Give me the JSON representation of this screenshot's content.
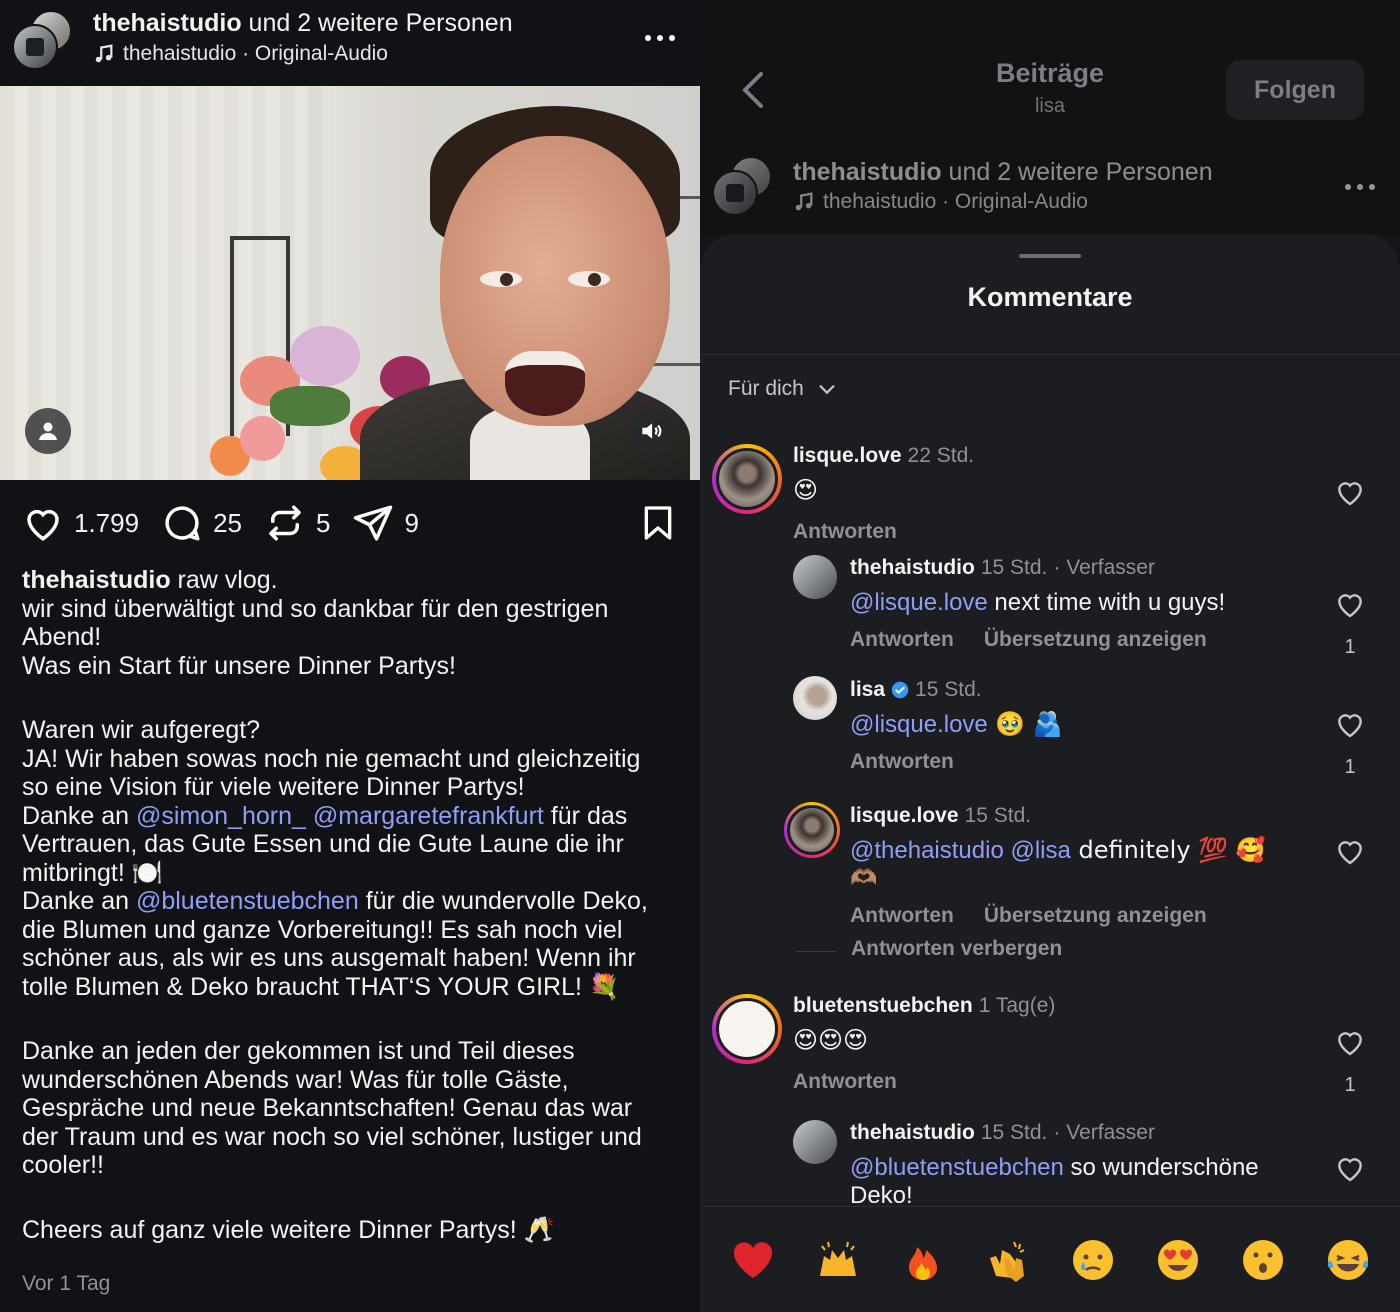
{
  "post": {
    "header": {
      "author": "thehaistudio",
      "coauthors_text": " und 2 weitere Personen",
      "audio_text": "thehaistudio · Original-Audio"
    },
    "stats": {
      "likes": "1.799",
      "comments": "25",
      "reposts": "5",
      "shares": "9"
    },
    "caption": {
      "author": "thehaistudio",
      "l1": " raw vlog.",
      "l2": "wir sind überwältigt und so dankbar für den gestrigen",
      "l3": "Abend!",
      "l4": "Was ein Start für unsere Dinner Partys!",
      "l5": "Waren wir aufgeregt?",
      "l6": "JA! Wir haben sowas noch nie gemacht und gleichzeitig",
      "l7": "so eine Vision für viele weitere Dinner Partys!",
      "l8a": "Danke an ",
      "mention1": "@simon_horn_",
      "mention2": "@margaretefrankfurt",
      "l8b": " für das",
      "l9": "Vertrauen, das Gute Essen und die Gute Laune die ihr",
      "l10": "mitbringt! 🍽️",
      "l11a": "Danke an ",
      "mention3": "@bluetenstuebchen",
      "l11b": " für die wundervolle Deko,",
      "l12": "die Blumen und ganze Vorbereitung!! Es sah noch viel",
      "l13": "schöner aus, als wir es uns ausgemalt haben! Wenn ihr",
      "l14": "tolle Blumen & Deko braucht THAT‘S YOUR GIRL! 💐",
      "l15": "Danke an jeden der gekommen ist und Teil dieses",
      "l16": "wunderschönen Abends war! Was für tolle Gäste,",
      "l17": "Gespräche und neue Bekanntschaften! Genau das war",
      "l18": "der Traum und es war noch so viel schöner, lustiger und",
      "l19": "cooler!!",
      "l20": "Cheers auf ganz viele weitere Dinner Partys! 🥂"
    },
    "time": "Vor 1 Tag"
  },
  "right": {
    "title": "Beiträge",
    "subtitle": "lisa",
    "follow_label": "Folgen",
    "bg_post": {
      "author": "thehaistudio",
      "coauthors_text": " und 2 weitere Personen",
      "audio_text": "thehaistudio · Original-Audio"
    }
  },
  "comments_sheet": {
    "title": "Kommentare",
    "sort_label": "Für dich",
    "reply_label": "Antworten",
    "translate_label": "Übersetzung anzeigen",
    "hide_replies_label": "Antworten verbergen",
    "author_tag": " · Verfasser",
    "c1": {
      "user": "lisque.love",
      "time": "22 Std.",
      "text": "😍"
    },
    "r1": {
      "user": "thehaistudio",
      "time": "15 Std.",
      "mention": "@lisque.love",
      "text": " next time with u guys!",
      "likes": "1"
    },
    "r2": {
      "user": "lisa",
      "time": "15 Std.",
      "mention": "@lisque.love",
      "text": " 🥹 🫂",
      "likes": "1"
    },
    "r3": {
      "user": "lisque.love",
      "time": "15 Std.",
      "mention1": "@thehaistudio",
      "mention2": "@lisa",
      "text": " definitely 💯 🥰",
      "text2": "🫶🏽"
    },
    "c2": {
      "user": "bluetenstuebchen",
      "time": "1 Tag(e)",
      "text": "😍😍😍",
      "likes": "1"
    },
    "r4": {
      "user": "thehaistudio",
      "time": "15 Std.",
      "mention": "@bluetenstuebchen",
      "text": " so wunderschöne",
      "text2": "Deko!"
    }
  },
  "emoji_bar": [
    {
      "name": "heart",
      "glyph": "❤️"
    },
    {
      "name": "raising-hands",
      "glyph": "🙌"
    },
    {
      "name": "fire",
      "glyph": "🔥"
    },
    {
      "name": "clapping-hands",
      "glyph": "👏"
    },
    {
      "name": "crying-face",
      "glyph": "😢"
    },
    {
      "name": "heart-eyes",
      "glyph": "😍"
    },
    {
      "name": "surprised-face",
      "glyph": "😮"
    },
    {
      "name": "tears-of-joy",
      "glyph": "😂"
    }
  ],
  "colors": {
    "background": "#101216",
    "sheet": "#1c1d21",
    "mention": "#8f9ff6",
    "muted": "#8e9196",
    "verified": "#3897f0"
  },
  "icons": [
    "music-note-icon",
    "more-icon",
    "user-icon",
    "sound-icon",
    "heart-icon",
    "comment-icon",
    "repost-icon",
    "share-icon",
    "bookmark-icon",
    "back-icon",
    "chevron-down-icon",
    "verified-icon"
  ]
}
